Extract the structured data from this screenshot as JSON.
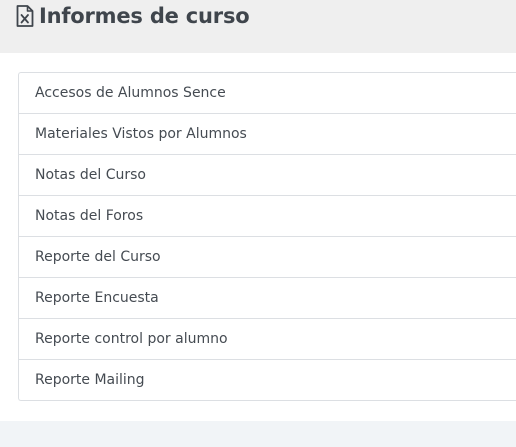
{
  "header": {
    "icon": "excel-file-icon",
    "title": "Informes de curso"
  },
  "reports": {
    "items": [
      {
        "label": "Accesos de Alumnos Sence"
      },
      {
        "label": "Materiales Vistos por Alumnos"
      },
      {
        "label": "Notas del Curso"
      },
      {
        "label": "Notas del Foros"
      },
      {
        "label": "Reporte del Curso"
      },
      {
        "label": "Reporte Encuesta"
      },
      {
        "label": "Reporte control por alumno"
      },
      {
        "label": "Reporte Mailing"
      }
    ]
  },
  "colors": {
    "header_bg": "#efefef",
    "page_bg": "#f1f4f7",
    "text": "#454b52",
    "border": "#dcdfe3"
  }
}
